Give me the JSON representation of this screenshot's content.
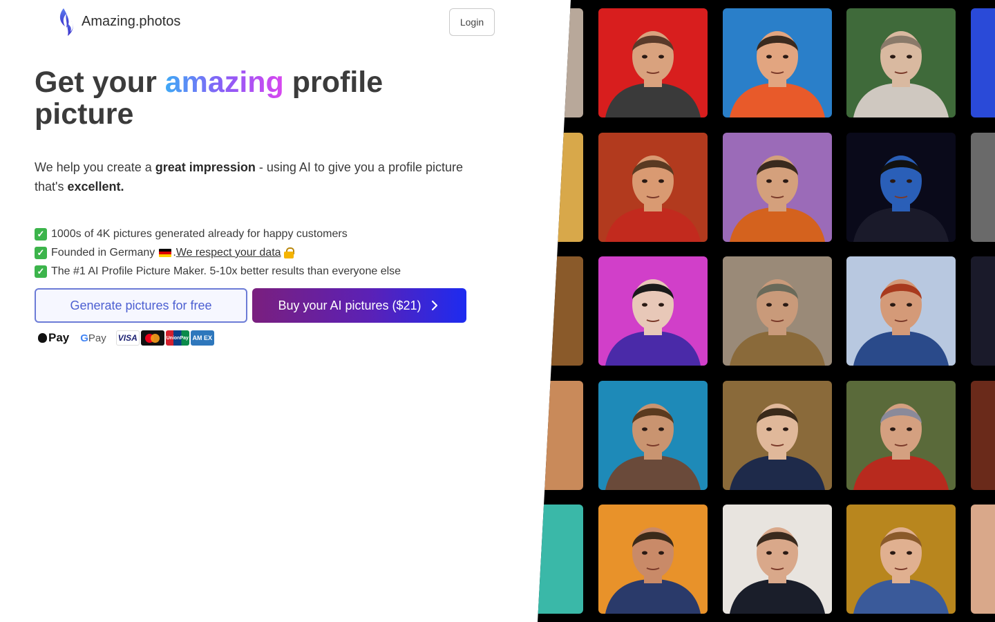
{
  "brand": {
    "name": "Amazing.photos",
    "logo_icon": "flame-logo-icon"
  },
  "header": {
    "login_label": "Login"
  },
  "hero": {
    "title_prefix": "Get your ",
    "title_accent": "amazing",
    "title_suffix": " profile picture",
    "subtitle": {
      "part1": "We help you create a ",
      "bold1": "great impression",
      "part2": " - using AI to give you a profile picture that's ",
      "bold2": "excellent."
    }
  },
  "features": {
    "item1": "1000s of 4K pictures generated already for happy customers",
    "item2_text": "Founded in Germany",
    "item2_sep": ". ",
    "item2_link": "We respect your data ",
    "item3": "The #1 AI Profile Picture Maker. 5-10x better results than everyone else"
  },
  "cta": {
    "free_label": "Generate pictures for free",
    "buy_label": "Buy your AI pictures ($21)"
  },
  "payments": {
    "apple_pay": "Pay",
    "google_pay_g": "G",
    "google_pay": " Pay",
    "visa": "VISA",
    "unionpay": "UnionPay",
    "amex": "AM EX"
  },
  "colors": {
    "accent_gradient": [
      "#3fa9f5",
      "#8b5cf6",
      "#d946ef"
    ],
    "buy_gradient": [
      "#7a1f7e",
      "#5b21b6",
      "#1d2bf0"
    ],
    "free_button_text": "#4c5fd1",
    "gallery_bg": "#000000"
  },
  "gallery": {
    "tiles": [
      {
        "bg": "#d81e1e",
        "skin": "#d9a27e",
        "shirt": "#3a3a3a",
        "hair": "#5a3a2a"
      },
      {
        "bg": "#2a7fc9",
        "skin": "#e2a580",
        "shirt": "#e85a2a",
        "hair": "#3b2a1e"
      },
      {
        "bg": "#3f6a3a",
        "skin": "#d9b9a0",
        "shirt": "#cfc8c0",
        "hair": "#8a7a6a"
      },
      {
        "bg": "#b23a1e",
        "skin": "#d99a72",
        "shirt": "#c22a1e",
        "hair": "#5a3a22"
      },
      {
        "bg": "#9b6bb8",
        "skin": "#d4a07c",
        "shirt": "#d4621e",
        "hair": "#3a2a1e"
      },
      {
        "bg": "#0a0a1a",
        "skin": "#2a5fb8",
        "shirt": "#1a1a2a",
        "hair": "#111111"
      },
      {
        "bg": "#d13fc9",
        "skin": "#e8c8b8",
        "shirt": "#4a2aa8",
        "hair": "#1a1a1a"
      },
      {
        "bg": "#9a8a78",
        "skin": "#c99a7a",
        "shirt": "#8a6a3a",
        "hair": "#6a6a5a"
      },
      {
        "bg": "#b8c8e0",
        "skin": "#d49a78",
        "shirt": "#2a4a8a",
        "hair": "#a83a1e"
      },
      {
        "bg": "#1e8ab8",
        "skin": "#c99470",
        "shirt": "#6a4a3a",
        "hair": "#5a3a1e"
      },
      {
        "bg": "#8a6a3a",
        "skin": "#e0b89a",
        "shirt": "#1e2a4a",
        "hair": "#3a2a1a"
      },
      {
        "bg": "#5a6a3a",
        "skin": "#d4a080",
        "shirt": "#b82a1e",
        "hair": "#8a8a9a"
      },
      {
        "bg": "#e8922a",
        "skin": "#c98a68",
        "shirt": "#2a3a6a",
        "hair": "#3a2a1a"
      },
      {
        "bg": "#e8e4df",
        "skin": "#d9a88a",
        "shirt": "#1a1e2a",
        "hair": "#3a2a1e"
      },
      {
        "bg": "#b8861e",
        "skin": "#e0b090",
        "shirt": "#3a5a9a",
        "hair": "#8a5a2a"
      }
    ],
    "edge_tiles": [
      {
        "bg": "#b8a89a"
      },
      {
        "bg": "#d8a84a"
      },
      {
        "bg": "#8a5a2a"
      },
      {
        "bg": "#c98a5a"
      },
      {
        "bg": "#3ab8a8"
      }
    ],
    "right_edge_tiles": [
      {
        "bg": "#2a4ad8"
      },
      {
        "bg": "#6a6a6a"
      },
      {
        "bg": "#1a1a2a"
      },
      {
        "bg": "#6a2a1a"
      },
      {
        "bg": "#d9a88a"
      }
    ]
  }
}
